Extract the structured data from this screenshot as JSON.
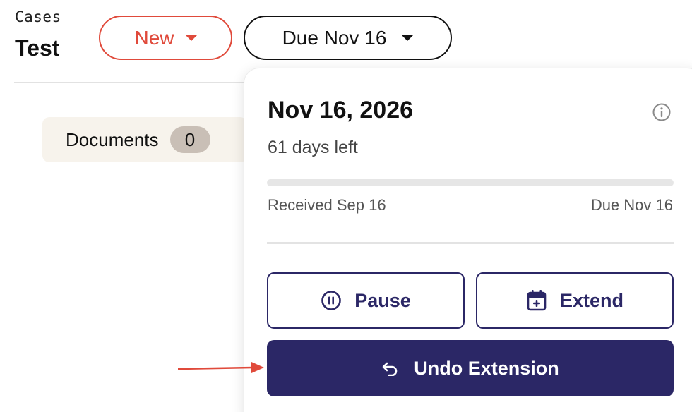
{
  "header": {
    "breadcrumb": "Cases",
    "title": "Test",
    "status_label": "New",
    "due_label": "Due Nov 16"
  },
  "tabs": {
    "documents_label": "Documents",
    "documents_count": "0"
  },
  "popover": {
    "date": "Nov 16, 2026",
    "days_left": "61 days left",
    "progress_fraction": 0.0,
    "received_label": "Received Sep 16",
    "due_label": "Due Nov 16",
    "pause_label": "Pause",
    "extend_label": "Extend",
    "undo_label": "Undo Extension"
  },
  "icons": {
    "info": "info-icon",
    "pause": "pause-icon",
    "calendar_plus": "calendar-plus-icon",
    "undo": "undo-icon",
    "caret": "chevron-down-icon"
  },
  "colors": {
    "accent_red": "#e04a3b",
    "primary_navy": "#2b2766",
    "annotation_red": "#e04a3b"
  }
}
